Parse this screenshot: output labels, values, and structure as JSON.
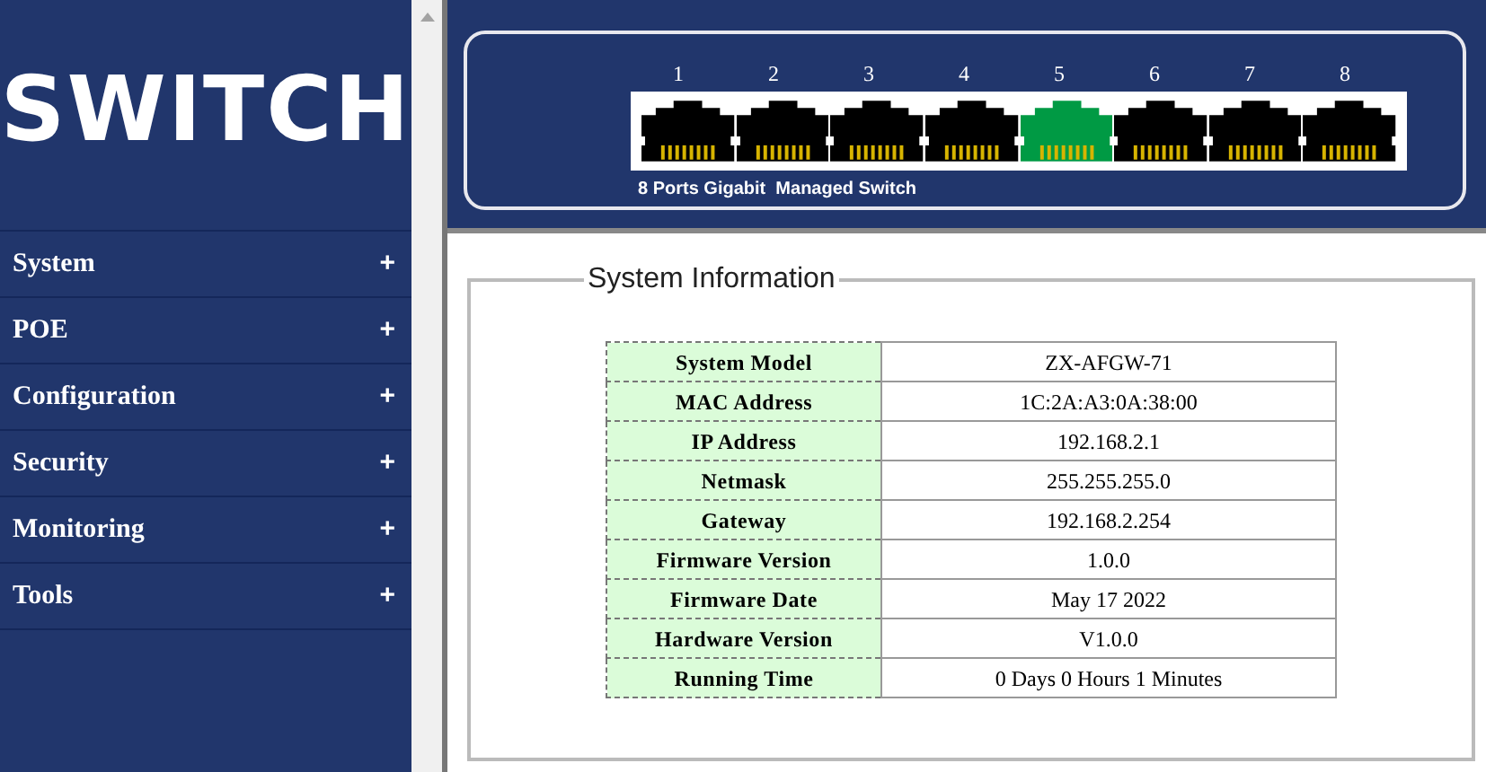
{
  "logo": "SWITCH",
  "menu": [
    {
      "label": "System",
      "icon": "+"
    },
    {
      "label": "POE",
      "icon": "+"
    },
    {
      "label": "Configuration",
      "icon": "+"
    },
    {
      "label": "Security",
      "icon": "+"
    },
    {
      "label": "Monitoring",
      "icon": "+"
    },
    {
      "label": "Tools",
      "icon": "+"
    }
  ],
  "ports": [
    {
      "number": "1",
      "active": false
    },
    {
      "number": "2",
      "active": false
    },
    {
      "number": "3",
      "active": false
    },
    {
      "number": "4",
      "active": false
    },
    {
      "number": "5",
      "active": true
    },
    {
      "number": "6",
      "active": false
    },
    {
      "number": "7",
      "active": false
    },
    {
      "number": "8",
      "active": false
    }
  ],
  "device_caption": "8 Ports Gigabit  Managed Switch",
  "section_title": "System Information",
  "info_rows": [
    {
      "label": "System Model",
      "value": "ZX-AFGW-71"
    },
    {
      "label": "MAC Address",
      "value": "1C:2A:A3:0A:38:00"
    },
    {
      "label": "IP Address",
      "value": "192.168.2.1"
    },
    {
      "label": "Netmask",
      "value": "255.255.255.0"
    },
    {
      "label": "Gateway",
      "value": "192.168.2.254"
    },
    {
      "label": "Firmware Version",
      "value": "1.0.0"
    },
    {
      "label": "Firmware Date",
      "value": "May 17 2022"
    },
    {
      "label": "Hardware Version",
      "value": "V1.0.0"
    },
    {
      "label": "Running Time",
      "value": "0 Days 0 Hours 1 Minutes"
    }
  ]
}
